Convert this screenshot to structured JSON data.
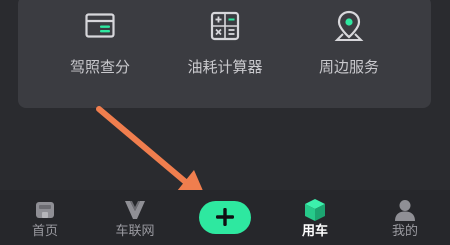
{
  "services": {
    "items": [
      {
        "label": "驾照查分",
        "icon": "license-card-icon"
      },
      {
        "label": "油耗计算器",
        "icon": "calculator-icon"
      },
      {
        "label": "周边服务",
        "icon": "location-pin-icon"
      }
    ]
  },
  "tabbar": {
    "tabs": [
      {
        "label": "首页",
        "icon": "home-icon",
        "active": false
      },
      {
        "label": "车联网",
        "icon": "car-network-icon",
        "active": false
      },
      {
        "label": "用车",
        "icon": "cube-icon",
        "active": true
      },
      {
        "label": "我的",
        "icon": "profile-icon",
        "active": false
      }
    ],
    "add_button": {
      "icon": "plus-icon"
    }
  },
  "colors": {
    "background": "#2a2b2f",
    "card": "#3b3c41",
    "accent": "#2ee8a0",
    "annotation_arrow": "#f07e4e"
  }
}
